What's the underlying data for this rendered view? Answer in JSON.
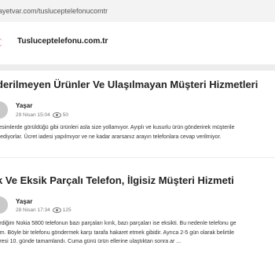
{
  "browser": {
    "url": "ayetvar.com/tusluceptelefonucomtr"
  },
  "site": {
    "name": "Tusluceptelefonu.com.tr"
  },
  "posts": [
    {
      "title": "derilmeyen Ürünler Ve Ulaşılmayan Müşteri Hizmetleri",
      "author": "Yaşar",
      "date": "29 Nisan 15:04",
      "views": "50",
      "excerpt": [
        ", resimlerde görüldüğü gibi ürünleri asla size yollamıyor. Ayıplı ve kusurlu ürün gönderirek müşterile",
        "er ediyorlar. Ücret iadesi yapılmıyor ve ne kadar ararsanız arayın telefonlara cevap verilmiyor."
      ]
    },
    {
      "title": "k Ve Eksik Parçalı Telefon, İlgisiz Müşteri Hizmeti",
      "author": "Yaşar",
      "date": "28 Nisan 17:34",
      "views": "125",
      "excerpt": [
        "verdiğim Nokia 5800 telefonun bazı parçaları kırık, bazı parçaları ise eksikti. Bu nedenle telefonu ge",
        "rdim. Böyle bir telefonu göndermek karşı tarafa hakaret etmek gibidir. Ayrıca 2-5 gün olarak belirtile",
        "süresi 10. günde tamamlandı. Cuma günü ürün ellerine ulaştıktan sonra ar ..."
      ]
    }
  ],
  "colors": {
    "accent": "#d32f2f"
  },
  "icons": {
    "views": "eye-icon",
    "logo": "brand-logo-icon"
  }
}
